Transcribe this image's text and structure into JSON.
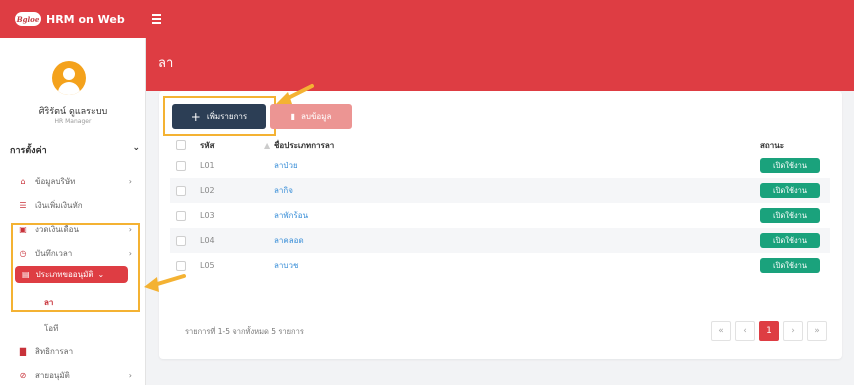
{
  "app": {
    "title": "HRM on Web",
    "logo_text": "Bgloe"
  },
  "page": {
    "title": "ลา"
  },
  "user": {
    "name": "ศิริรัตน์ ดูแลระบบ",
    "role": "HR Manager"
  },
  "sidebar": {
    "heading": "การตั้งค่า",
    "items": [
      {
        "icon": "home-icon",
        "label": "ข้อมูลบริษัท",
        "has_chevron": true
      },
      {
        "icon": "list-icon",
        "label": "เงินเพิ่มเงินหัก",
        "has_chevron": false
      },
      {
        "icon": "money-icon",
        "label": "งวดเงินเดือน",
        "has_chevron": true
      },
      {
        "icon": "clock-icon",
        "label": "บันทึกเวลา",
        "has_chevron": true
      },
      {
        "icon": "leave-type-icon",
        "label": "ประเภทขออนุมัติ",
        "active": true
      },
      {
        "label": "ลา",
        "sub_active": true
      },
      {
        "label": "โอที"
      },
      {
        "icon": "document-icon",
        "label": "สิทธิการลา"
      },
      {
        "icon": "check-circle-icon",
        "label": "สายอนุมัติ",
        "has_chevron": true
      }
    ]
  },
  "toolbar": {
    "add_label": "เพิ่มรายการ",
    "delete_label": "ลบข้อมูล"
  },
  "table": {
    "headers": {
      "code": "รหัส",
      "type": "ชื่อประเภทการลา",
      "status": "สถานะ"
    },
    "rows": [
      {
        "code": "L01",
        "type": "ลาป่วย",
        "status": "เปิดใช้งาน"
      },
      {
        "code": "L02",
        "type": "ลากิจ",
        "status": "เปิดใช้งาน"
      },
      {
        "code": "L03",
        "type": "ลาพักร้อน",
        "status": "เปิดใช้งาน"
      },
      {
        "code": "L04",
        "type": "ลาคลอด",
        "status": "เปิดใช้งาน"
      },
      {
        "code": "L05",
        "type": "ลาบวช",
        "status": "เปิดใช้งาน"
      }
    ]
  },
  "pagination": {
    "info": "รายการที่ 1-5 จากทั้งหมด 5 รายการ",
    "current_page": "1",
    "first": "«",
    "prev": "‹",
    "next": "›",
    "last": "»"
  },
  "colors": {
    "brand_red": "#de3d43",
    "navy": "#2c3e55",
    "status_green": "#1aa27c",
    "highlight": "#f4b233"
  }
}
